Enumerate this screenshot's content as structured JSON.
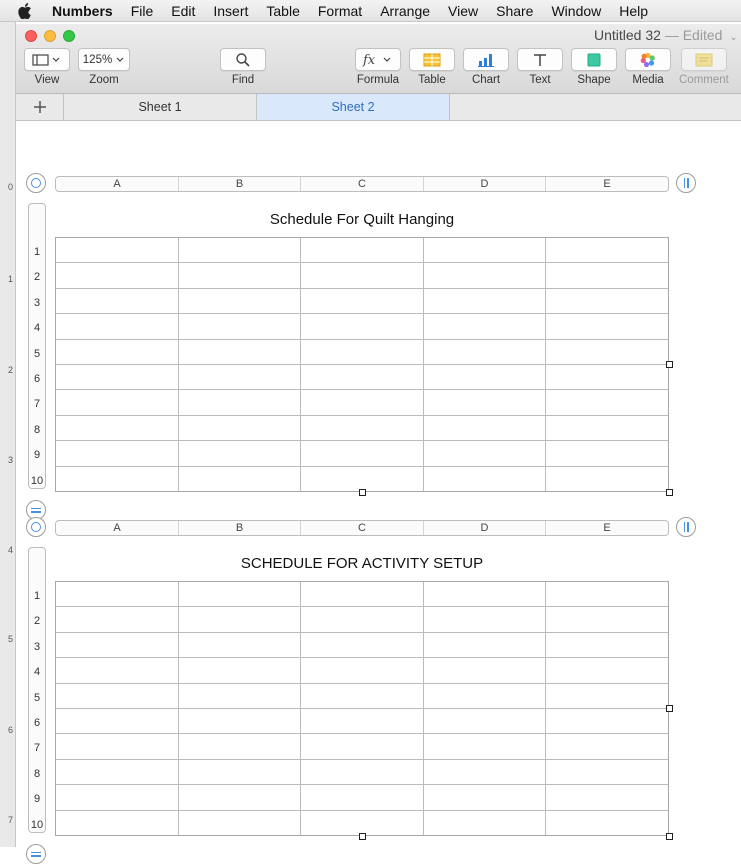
{
  "menubar": {
    "app": "Numbers",
    "items": [
      "File",
      "Edit",
      "Insert",
      "Table",
      "Format",
      "Arrange",
      "View",
      "Share",
      "Window",
      "Help"
    ]
  },
  "left_strip": {
    "ticks": [
      "0",
      "1",
      "2",
      "3",
      "4",
      "5",
      "6",
      "7"
    ]
  },
  "window": {
    "title": "Untitled 32",
    "edited": "— Edited",
    "edited_chevron": "⌄"
  },
  "toolbar": {
    "view_label": "View",
    "zoom_value": "125%",
    "zoom_label": "Zoom",
    "find_label": "Find",
    "formula_label": "Formula",
    "table_label": "Table",
    "chart_label": "Chart",
    "text_label": "Text",
    "shape_label": "Shape",
    "media_label": "Media",
    "comment_label": "Comment"
  },
  "tabs": [
    {
      "label": "Sheet 1",
      "active": false
    },
    {
      "label": "Sheet 2",
      "active": true
    }
  ],
  "tables": [
    {
      "title": "Schedule For Quilt Hanging",
      "columns": [
        "A",
        "B",
        "C",
        "D",
        "E"
      ],
      "rows": [
        "1",
        "2",
        "3",
        "4",
        "5",
        "6",
        "7",
        "8",
        "9",
        "10"
      ]
    },
    {
      "title": "SCHEDULE FOR ACTIVITY SETUP",
      "columns": [
        "A",
        "B",
        "C",
        "D",
        "E"
      ],
      "rows": [
        "1",
        "2",
        "3",
        "4",
        "5",
        "6",
        "7",
        "8",
        "9",
        "10"
      ]
    }
  ],
  "colors": {
    "accent": "#4a90e2",
    "active_tab_bg": "#d9e9fb",
    "active_tab_text": "#2f6fbf"
  }
}
